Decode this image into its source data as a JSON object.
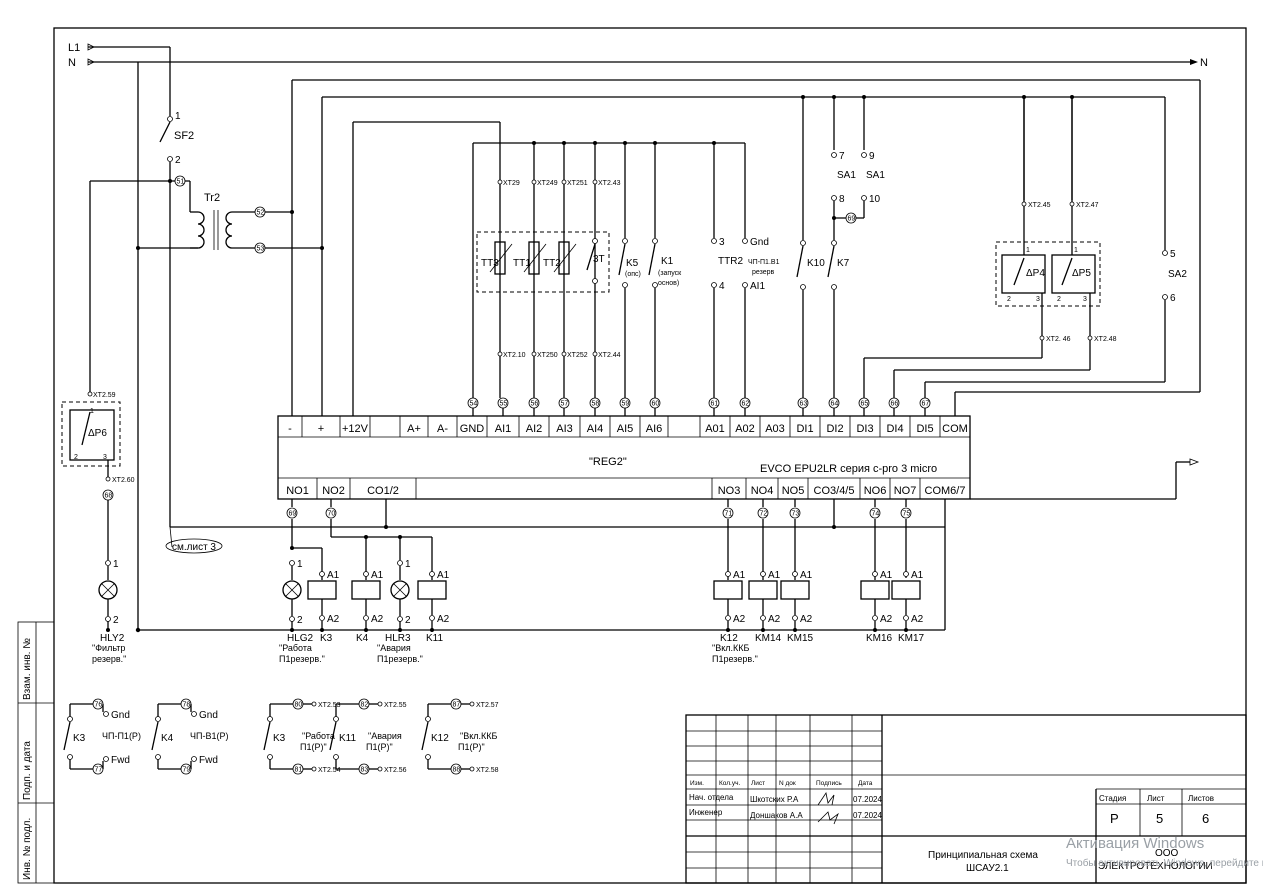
{
  "rails": {
    "l1": "L1",
    "n_left": "N",
    "n_right": "N"
  },
  "breaker": {
    "name": "SF2",
    "pin1": "1",
    "pin2": "2"
  },
  "transformer": {
    "name": "Tr2",
    "node51": "51",
    "node52": "52",
    "node53": "53"
  },
  "filter_sensor": {
    "name": "ΔP6",
    "xt_top": "XT2.59",
    "xt_bottom": "XT2.60",
    "pin1": "1",
    "pin2": "2",
    "pin3": "3",
    "node68": "68"
  },
  "temp_sensors": {
    "tt3": "TT3",
    "tt1": "TT1",
    "tt2": "TT2",
    "t3": "3T",
    "xt_top": [
      "XT29",
      "XT249",
      "XT251",
      "XT2.43"
    ],
    "xt_bottom": [
      "XT2.10",
      "XT250",
      "XT252",
      "XT2.44"
    ]
  },
  "inputs": {
    "k5": "K5",
    "k5_sub": "(опс)",
    "k1": "K1",
    "k1_sub1": "(запуск",
    "k1_sub2": "основ)",
    "ttr2": "TTR2",
    "ttr2_pin3": "3",
    "ttr2_pin4": "4",
    "cp_gnd": "Gnd",
    "cp_name": "ЧП-П1.В1",
    "cp_sub": "резерв",
    "cp_ai1": "AI1",
    "k10": "K10",
    "k7": "K7",
    "sa1a": "SA1",
    "sa1a_p7": "7",
    "sa1a_p8": "8",
    "sa1b": "SA1",
    "sa1b_p9": "9",
    "sa1b_p10": "10",
    "node69": "69",
    "dp4": "ΔP4",
    "dp5": "ΔP5",
    "xt245": "XT2.45",
    "xt247": "XT2.47",
    "xt246": "XT2. 46",
    "xt248": "XT2.48",
    "dp_p1": "1",
    "dp_p2": "2",
    "dp_p3": "3",
    "sa2": "SA2",
    "sa2_p5": "5",
    "sa2_p6": "6"
  },
  "controller": {
    "name": "\"REG2\"",
    "model": "EVCO EPU2LR серия c-pro 3 micro",
    "top_terminals": [
      "-",
      "+",
      "+12V",
      "A+",
      "A-",
      "GND",
      "AI1",
      "AI2",
      "AI3",
      "AI4",
      "AI5",
      "AI6",
      "A01",
      "A02",
      "A03",
      "DI1",
      "DI2",
      "DI3",
      "DI4",
      "DI5",
      "COM"
    ],
    "top_nodes": [
      "54",
      "55",
      "56",
      "57",
      "58",
      "59",
      "60",
      "61",
      "62",
      "63",
      "64",
      "65",
      "66",
      "67"
    ],
    "bottom_terminals": [
      "NO1",
      "NO2",
      "CO1/2",
      "NO3",
      "NO4",
      "NO5",
      "CO3/4/5",
      "NO6",
      "NO7",
      "COM6/7"
    ],
    "bottom_nodes": [
      "69",
      "70",
      "71",
      "72",
      "73",
      "74",
      "75"
    ],
    "see_sheet": "см.лист 3"
  },
  "outputs": [
    {
      "label": "HLY2",
      "sub1": "\"Фильтр",
      "sub2": "резерв.\""
    },
    {
      "label": "HLG2",
      "sub1": "\"Работа",
      "sub2": "П1резерв.\""
    },
    {
      "label": "K3",
      "sub1": "",
      "sub2": ""
    },
    {
      "label": "K4",
      "sub1": "",
      "sub2": ""
    },
    {
      "label": "HLR3",
      "sub1": "\"Авария",
      "sub2": "П1резерв.\""
    },
    {
      "label": "K11",
      "sub1": "",
      "sub2": ""
    },
    {
      "label": "K12",
      "sub1": "\"Вкл.ККБ",
      "sub2": "П1резерв.\""
    },
    {
      "label": "KM14",
      "sub1": "",
      "sub2": ""
    },
    {
      "label": "KM15",
      "sub1": "",
      "sub2": ""
    },
    {
      "label": "KM16",
      "sub1": "",
      "sub2": ""
    },
    {
      "label": "KM17",
      "sub1": "",
      "sub2": ""
    }
  ],
  "coil_pins": {
    "a1": "A1",
    "a2": "A2",
    "p1": "1",
    "p2": "2"
  },
  "aux_contacts": [
    {
      "k": "K3",
      "top_node": "76",
      "bottom_node": "77",
      "top_label": "Gnd",
      "bottom_label": "Fwd",
      "name1": "ЧП-П1(Р)",
      "name2": ""
    },
    {
      "k": "K4",
      "top_node": "78",
      "bottom_node": "79",
      "top_label": "Gnd",
      "bottom_label": "Fwd",
      "name1": "ЧП-В1(Р)",
      "name2": ""
    },
    {
      "k": "K3",
      "top_node": "80",
      "bottom_node": "81",
      "top_label": "XT2.53",
      "bottom_label": "XT2.54",
      "name1": "\"Работа",
      "name2": "П1(Р)\""
    },
    {
      "k": "K11",
      "top_node": "82",
      "bottom_node": "83",
      "top_label": "XT2.55",
      "bottom_label": "XT2.56",
      "name1": "\"Авария",
      "name2": "П1(Р)\""
    },
    {
      "k": "K12",
      "top_node": "87",
      "bottom_node": "88",
      "top_label": "XT2.57",
      "bottom_label": "XT2.58",
      "name1": "\"Вкл.ККБ",
      "name2": "П1(Р)\""
    }
  ],
  "side_stamp": {
    "c1": "Взам. инв. №",
    "c2": "Подп. и дата",
    "c3": "Инв. № подл."
  },
  "title_block": {
    "headers": [
      "Изм.",
      "Кол.уч.",
      "Лист",
      "N док",
      "Подпись",
      "Дата"
    ],
    "row1_role": "Нач. отдела",
    "row1_name": "Шкотских Р.А",
    "row1_date": "07.2024",
    "row2_role": "Инженер",
    "row2_name": "Доншаков А.А",
    "row2_date": "07.2024",
    "title1": "Принципиальная схема",
    "title2": "ШСАУ2.1",
    "stage_h": "Стадия",
    "sheet_h": "Лист",
    "sheets_h": "Листов",
    "stage": "Р",
    "sheet": "5",
    "sheets": "6",
    "org1": "ООО",
    "org2": "ЭЛЕКТРОТЕХНОЛОГИИ"
  },
  "watermark": {
    "line1": "Активация Windows",
    "line2": "Чтобы активировать Windows, перейдите в раздел"
  }
}
